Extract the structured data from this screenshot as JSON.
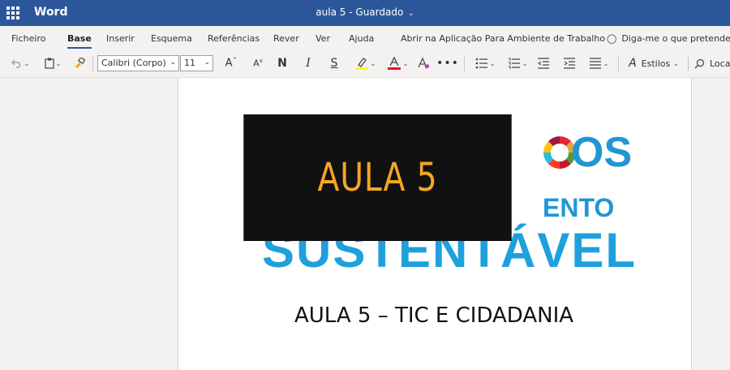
{
  "titlebar": {
    "app_name": "Word",
    "document_name": "aula 5",
    "separator": "-",
    "save_status": "Guardado"
  },
  "ribbon_tabs": [
    {
      "label": "Ficheiro",
      "active": false
    },
    {
      "label": "Base",
      "active": true
    },
    {
      "label": "Inserir",
      "active": false
    },
    {
      "label": "Esquema",
      "active": false
    },
    {
      "label": "Referências",
      "active": false
    },
    {
      "label": "Rever",
      "active": false
    },
    {
      "label": "Ver",
      "active": false
    },
    {
      "label": "Ajuda",
      "active": false
    },
    {
      "label": "Abrir na Aplicação Para Ambiente de Trabalho",
      "active": false
    }
  ],
  "tell_me": {
    "placeholder": "Diga-me o que pretende fazer",
    "icon": "lightbulb-icon"
  },
  "toolbar": {
    "font_name": "Calibri (Corpo)",
    "font_size": "11",
    "bold_label": "N",
    "italic_label": "I",
    "underline_label": "S",
    "styles_label": "Estilos",
    "find_label": "Localizar",
    "highlight_color": "#ffff00",
    "font_color": "#e81123"
  },
  "document": {
    "image_text": {
      "line1_partial": "OS",
      "line2_partial": "ENTO",
      "line3": "SUSTENTÁVEL"
    },
    "overlay_text": "AULA 5",
    "heading": "AULA 5 – TIC E CIDADANIA"
  },
  "colors": {
    "titlebar_bg": "#2b579a",
    "overlay_bg": "#111111",
    "overlay_text": "#f5a623",
    "sdg_blue": "#1ea0dc"
  }
}
